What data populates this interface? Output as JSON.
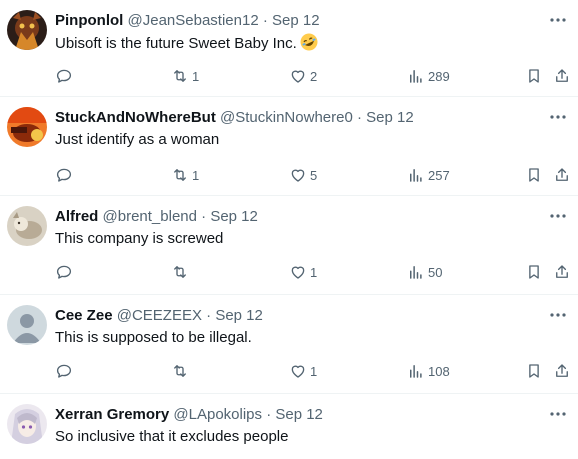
{
  "tweets": [
    {
      "name": "Pinponlol",
      "handle": "@JeanSebastien12",
      "separator": "·",
      "date": "Sep 12",
      "text": "Ubisoft is the future Sweet Baby Inc.",
      "emoji": "rolling-on-floor-laughing-emoji",
      "retweets": "1",
      "likes": "2",
      "views": "289",
      "avatar_color": "#3a2a22"
    },
    {
      "name": "StuckAndNoWhereBut",
      "handle": "@StuckinNowhere0",
      "separator": "·",
      "date": "Sep 12",
      "text": "Just identify as a woman",
      "retweets": "1",
      "likes": "5",
      "views": "257",
      "avatar_color": "#c8501e"
    },
    {
      "name": "Alfred",
      "handle": "@brent_blend",
      "separator": "·",
      "date": "Sep 12",
      "text": "This company is screwed",
      "retweets": "",
      "likes": "1",
      "views": "50",
      "avatar_color": "#c9c2b4"
    },
    {
      "name": "Cee Zee",
      "handle": "@CEEZEEX",
      "separator": "·",
      "date": "Sep 12",
      "text": "This is supposed to be illegal.",
      "retweets": "",
      "likes": "1",
      "views": "108",
      "avatar_color": "#cfd9de"
    },
    {
      "name": "Xerran Gremory",
      "handle": "@LApokolips",
      "separator": "·",
      "date": "Sep 12",
      "text": "So inclusive that it excludes people",
      "avatar_color": "#e9e4ec"
    }
  ],
  "colors": {
    "text_primary": "#0f1419",
    "text_secondary": "#536471",
    "divider": "#eff3f4"
  }
}
